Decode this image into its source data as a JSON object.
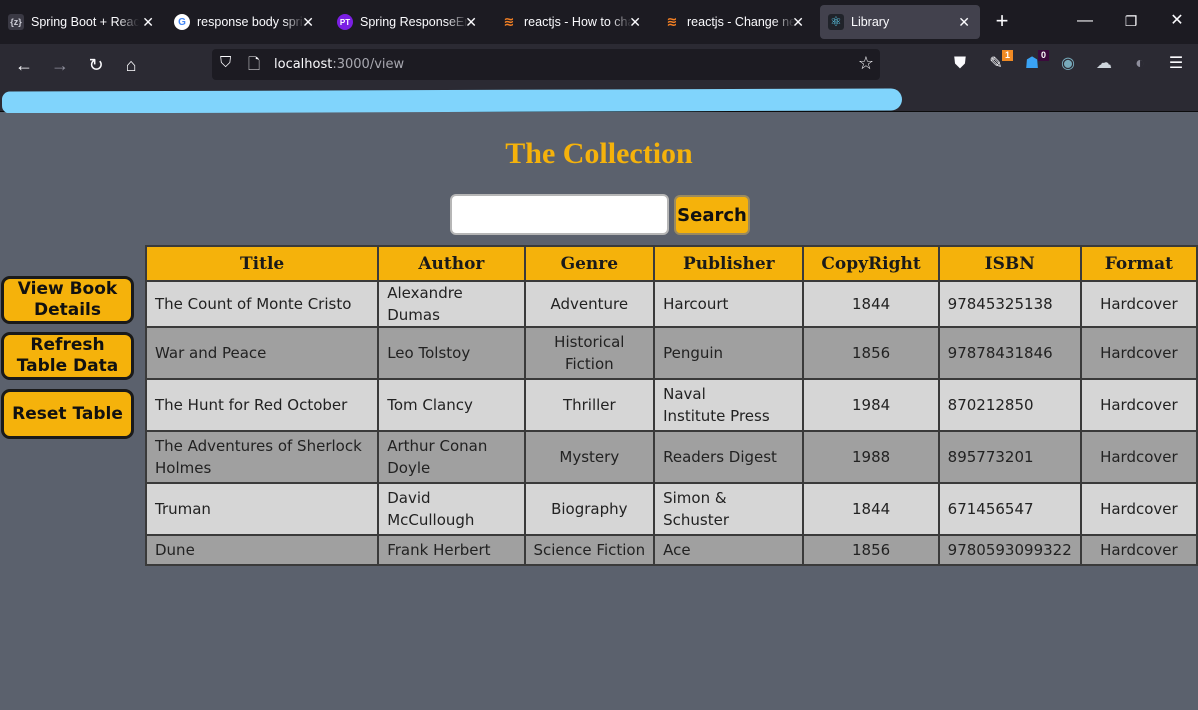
{
  "browser": {
    "tabs": [
      {
        "title": "Spring Boot + React",
        "icon": "z-bracket-icon",
        "active": false
      },
      {
        "title": "response body spring",
        "icon": "google-icon",
        "active": false
      },
      {
        "title": "Spring ResponseEntity",
        "icon": "pt-icon",
        "active": false
      },
      {
        "title": "reactjs - How to change",
        "icon": "stackoverflow-icon",
        "active": false
      },
      {
        "title": "reactjs - Change nested",
        "icon": "stackoverflow-icon",
        "active": false
      },
      {
        "title": "Library",
        "icon": "react-icon",
        "active": true
      }
    ],
    "icon_glyphs": {
      "z_bracket": "{z}",
      "pt": "PT",
      "google": "G"
    },
    "url": {
      "host": "localhost",
      "rest": ":3000/view"
    },
    "extension_badges": {
      "ext1": "1",
      "ext2": "0"
    },
    "bookmarks_redacted": true
  },
  "page": {
    "heading": "The Collection",
    "search": {
      "value": "",
      "placeholder": "",
      "button_label": "Search"
    },
    "side_buttons": [
      {
        "label_line1": "View Book",
        "label_line2": "Details"
      },
      {
        "label_line1": "Refresh",
        "label_line2": "Table Data"
      },
      {
        "label_line1": "Reset Table",
        "label_line2": ""
      }
    ],
    "table": {
      "columns": [
        "Title",
        "Author",
        "Genre",
        "Publisher",
        "CopyRight",
        "ISBN",
        "Format"
      ],
      "rows": [
        {
          "title": "The Count of Monte Cristo",
          "author": "Alexandre Dumas",
          "genre": "Adventure",
          "publisher": "Harcourt",
          "copyright": "1844",
          "isbn": "97845325138",
          "format": "Hardcover"
        },
        {
          "title": "War and Peace",
          "author": "Leo Tolstoy",
          "genre": "Historical Fiction",
          "publisher": "Penguin",
          "copyright": "1856",
          "isbn": "97878431846",
          "format": "Hardcover"
        },
        {
          "title": "The Hunt for Red October",
          "author": "Tom Clancy",
          "genre": "Thriller",
          "publisher": "Naval Institute Press",
          "copyright": "1984",
          "isbn": "870212850",
          "format": "Hardcover"
        },
        {
          "title": "The Adventures of Sherlock Holmes",
          "author": "Arthur Conan Doyle",
          "genre": "Mystery",
          "publisher": "Readers Digest",
          "copyright": "1988",
          "isbn": "895773201",
          "format": "Hardcover"
        },
        {
          "title": "Truman",
          "author": "David McCullough",
          "genre": "Biography",
          "publisher": "Simon & Schuster",
          "copyright": "1844",
          "isbn": "671456547",
          "format": "Hardcover"
        },
        {
          "title": "Dune",
          "author": "Frank Herbert",
          "genre": "Science Fiction",
          "publisher": "Ace",
          "copyright": "1856",
          "isbn": "9780593099322",
          "format": "Hardcover"
        }
      ]
    }
  },
  "colors": {
    "accent": "#f5b20b",
    "page_bg": "#5b616d",
    "row_light": "#d6d6d6",
    "row_dark": "#a0a0a0",
    "table_border": "#3a3a3a"
  }
}
